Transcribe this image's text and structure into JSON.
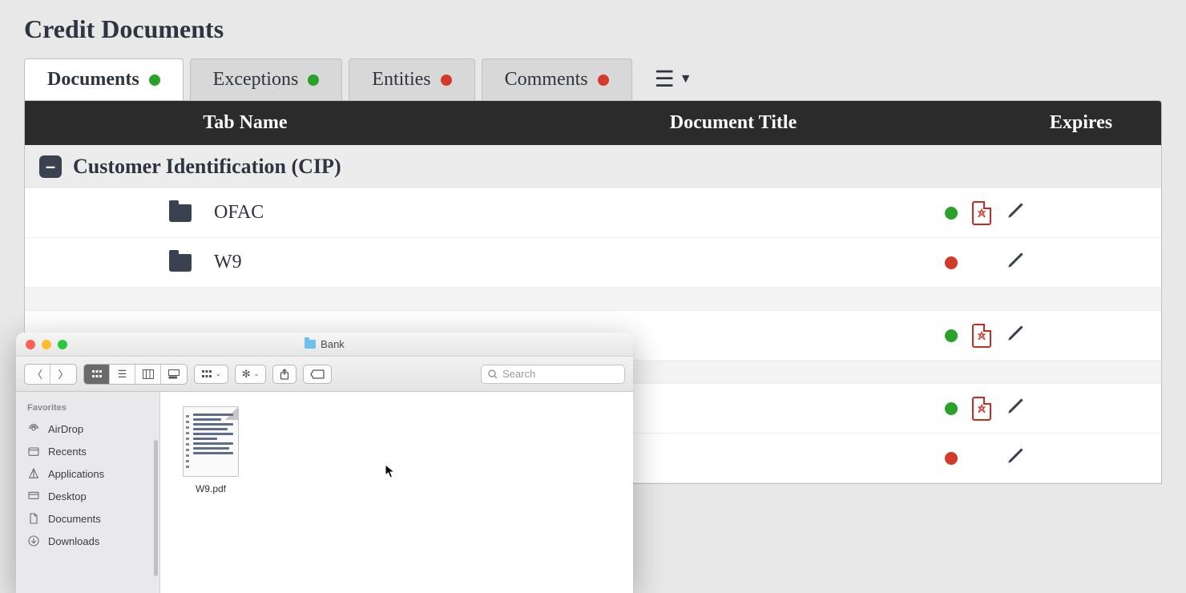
{
  "page": {
    "title": "Credit Documents"
  },
  "tabs": [
    {
      "label": "Documents",
      "status": "green",
      "active": true
    },
    {
      "label": "Exceptions",
      "status": "green",
      "active": false
    },
    {
      "label": "Entities",
      "status": "red",
      "active": false
    },
    {
      "label": "Comments",
      "status": "red",
      "active": false
    }
  ],
  "columns": {
    "tabName": "Tab Name",
    "docTitle": "Document Title",
    "expires": "Expires"
  },
  "group": {
    "label": "Customer Identification (CIP)"
  },
  "rows": [
    {
      "name": "OFAC",
      "status": "green",
      "hasPdf": true,
      "alt": false
    },
    {
      "name": "W9",
      "status": "red",
      "hasPdf": false,
      "alt": false
    },
    {
      "name": "",
      "status": "",
      "hasPdf": false,
      "alt": true
    },
    {
      "name": "",
      "status": "green",
      "hasPdf": true,
      "alt": false
    },
    {
      "name": "",
      "status": "",
      "hasPdf": false,
      "alt": true
    },
    {
      "name": "",
      "status": "green",
      "hasPdf": true,
      "alt": false
    },
    {
      "name": "",
      "status": "red",
      "hasPdf": false,
      "alt": false
    }
  ],
  "finder": {
    "title": "Bank",
    "search_placeholder": "Search",
    "favorites_heading": "Favorites",
    "favorites": [
      "AirDrop",
      "Recents",
      "Applications",
      "Desktop",
      "Documents",
      "Downloads"
    ],
    "file": {
      "name": "W9.pdf"
    }
  }
}
